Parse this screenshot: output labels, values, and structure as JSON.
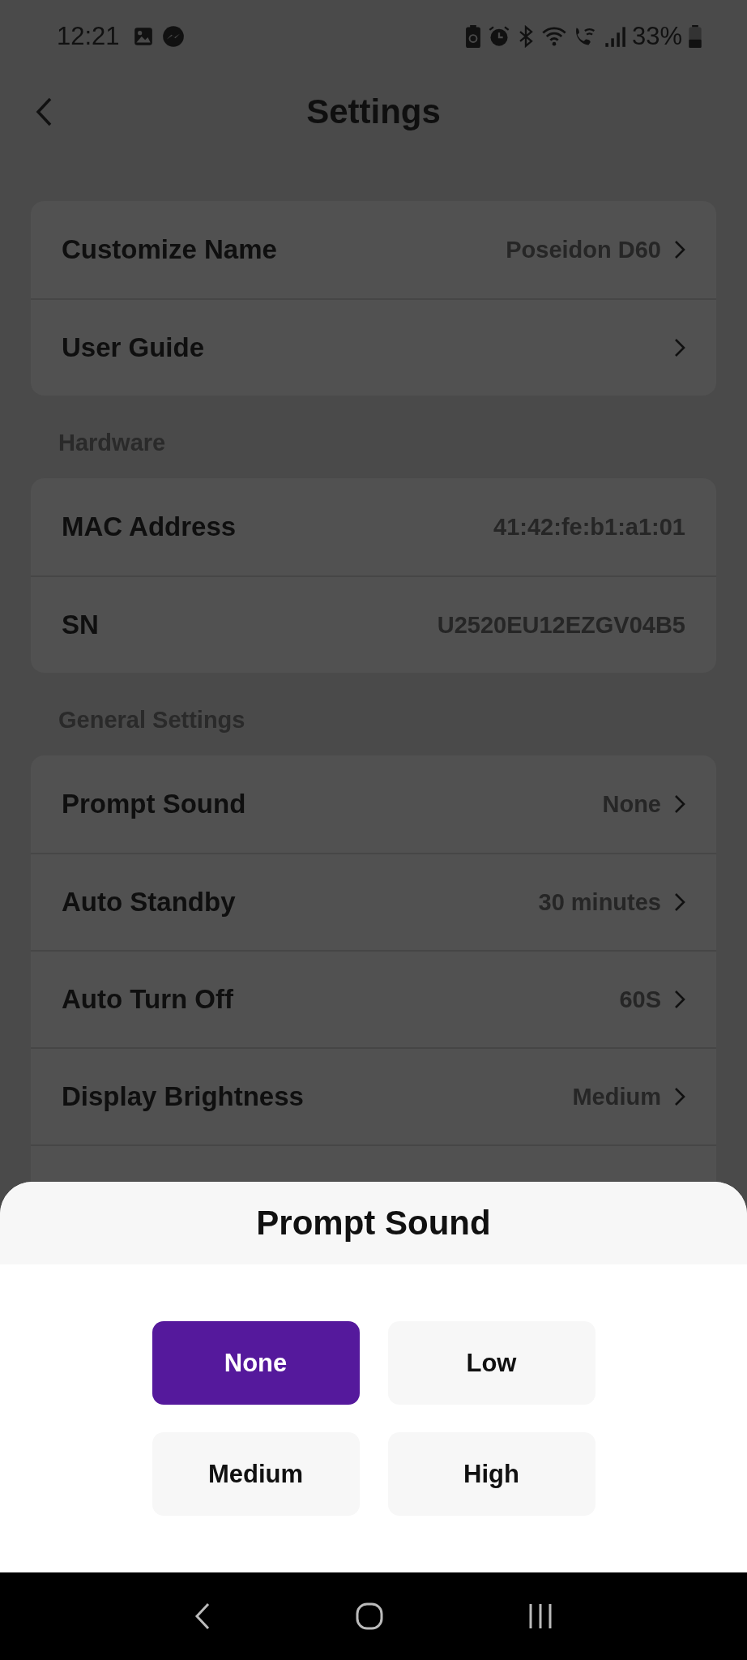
{
  "status_bar": {
    "time": "12:21",
    "battery": "33%"
  },
  "header": {
    "title": "Settings"
  },
  "sections": [
    {
      "rows": [
        {
          "kind": "link",
          "label": "Customize Name",
          "value": "Poseidon D60"
        },
        {
          "kind": "link",
          "label": "User Guide"
        }
      ]
    },
    {
      "title": "Hardware",
      "rows": [
        {
          "kind": "info",
          "label": "MAC Address",
          "value": "41:42:fe:b1:a1:01"
        },
        {
          "kind": "info",
          "label": "SN",
          "value": "U2520EU12EZGV04B5"
        }
      ]
    },
    {
      "title": "General Settings",
      "rows": [
        {
          "kind": "link",
          "label": "Prompt Sound",
          "value": "None"
        },
        {
          "kind": "link",
          "label": "Auto Standby",
          "value": "30 minutes"
        },
        {
          "kind": "link",
          "label": "Auto Turn Off",
          "value": "60S"
        },
        {
          "kind": "link",
          "label": "Display Brightness",
          "value": "Medium"
        },
        {
          "kind": "covered"
        }
      ]
    }
  ],
  "sheet": {
    "title": "Prompt Sound",
    "options": [
      {
        "label": "None",
        "selected": true
      },
      {
        "label": "Low",
        "selected": false
      },
      {
        "label": "Medium",
        "selected": false
      },
      {
        "label": "High",
        "selected": false
      }
    ]
  }
}
